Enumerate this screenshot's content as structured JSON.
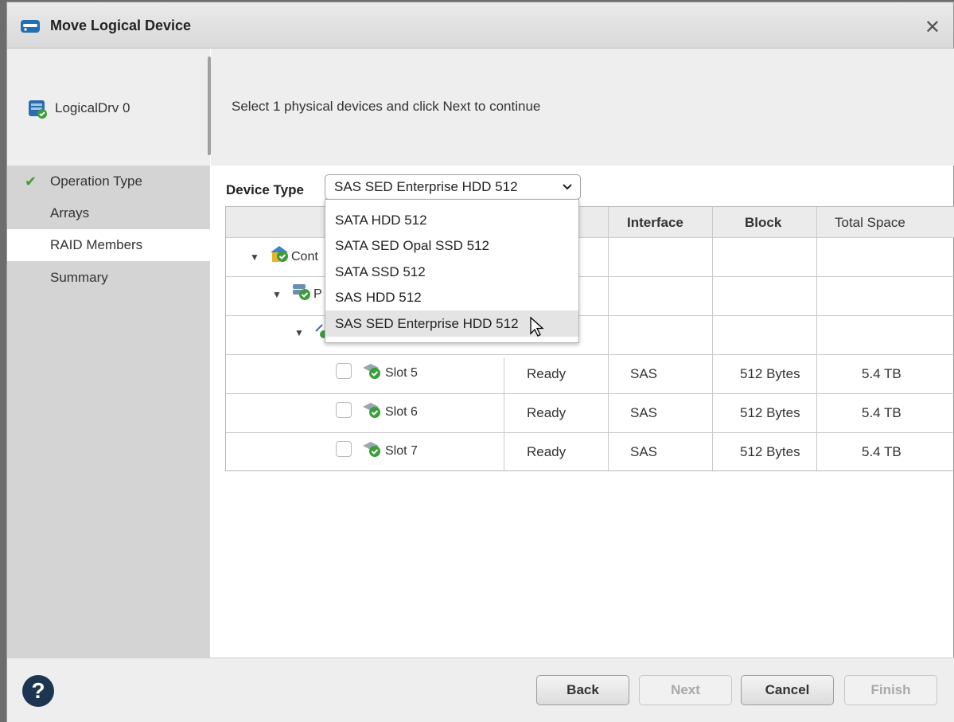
{
  "window": {
    "title": "Move Logical Device",
    "close_glyph": "✕"
  },
  "header": {
    "logical_drive": "LogicalDrv 0",
    "instruction": "Select 1 physical devices and click Next to continue"
  },
  "steps": [
    {
      "label": "Operation Type",
      "completed": true,
      "check_glyph": "✔"
    },
    {
      "label": "Arrays"
    },
    {
      "label": "RAID Members",
      "active": true
    },
    {
      "label": "Summary"
    }
  ],
  "device_type": {
    "label": "Device Type",
    "selected": "SAS SED Enterprise HDD 512",
    "caret": "⌄",
    "options": [
      "SATA HDD 512",
      "SATA SED Opal SSD 512",
      "SATA SSD 512",
      "SAS HDD 512",
      "SAS SED Enterprise HDD 512"
    ],
    "highlighted_index": 4
  },
  "table": {
    "columns": [
      "Interface",
      "Block",
      "Total Space"
    ],
    "tree": [
      {
        "label": "Cont",
        "arrow": "▼"
      },
      {
        "label": "P",
        "arrow": "▼"
      },
      {
        "arrow": "▼"
      }
    ],
    "rows": [
      {
        "name": "Slot 5",
        "state": "Ready",
        "interface": "SAS",
        "block": "512 Bytes",
        "size": "5.4 TB"
      },
      {
        "name": "Slot 6",
        "state": "Ready",
        "interface": "SAS",
        "block": "512 Bytes",
        "size": "5.4 TB"
      },
      {
        "name": "Slot 7",
        "state": "Ready",
        "interface": "SAS",
        "block": "512 Bytes",
        "size": "5.4 TB"
      }
    ]
  },
  "footer": {
    "help": "?",
    "back": "Back",
    "next": "Next",
    "cancel": "Cancel",
    "finish": "Finish"
  },
  "colors": {
    "check": "#4a9a2c",
    "help": "#1c3550",
    "accent": "#1f6fb2"
  }
}
